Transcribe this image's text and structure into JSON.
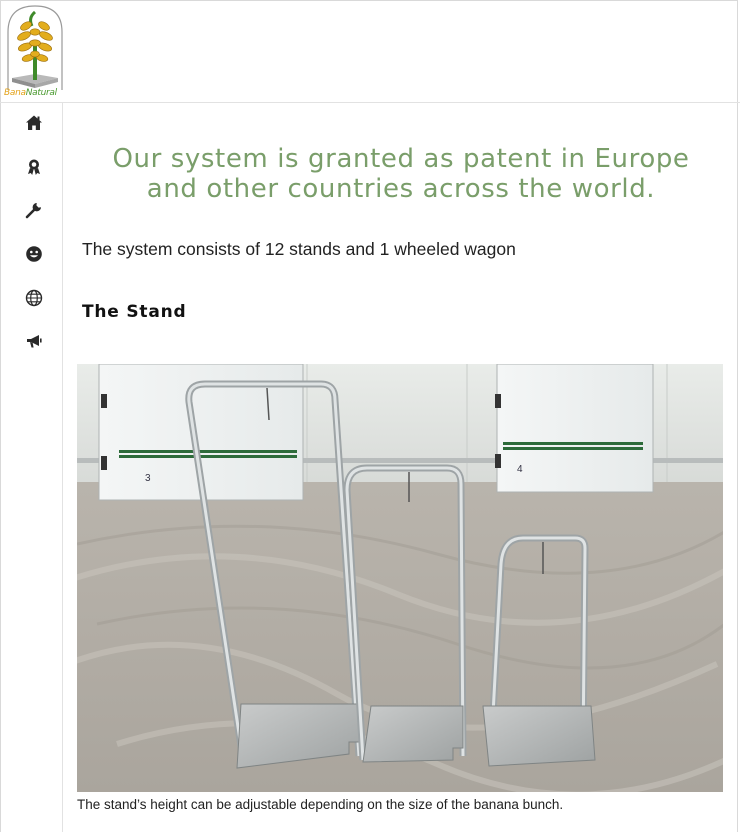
{
  "brand": {
    "name_part1": "Bana",
    "name_part2": "Natural"
  },
  "nav": {
    "items": [
      {
        "icon": "home-icon"
      },
      {
        "icon": "award-icon"
      },
      {
        "icon": "wrench-icon"
      },
      {
        "icon": "smiley-icon"
      },
      {
        "icon": "globe-icon"
      },
      {
        "icon": "megaphone-icon"
      }
    ]
  },
  "content": {
    "headline_line1": "Our system is granted as patent in Europe",
    "headline_line2": "and other countries across the world.",
    "intro": "The system consists of 12 stands and 1 wheeled wagon",
    "section_title": "The Stand",
    "photo": {
      "door_left_number": "3",
      "door_right_number": "4"
    },
    "caption": "The stand’s height can be adjustable depending on the size of the banana bunch."
  },
  "colors": {
    "headline": "#7a9e6a",
    "logo_yellow": "#e3a21a",
    "logo_green": "#4a9a2f"
  }
}
